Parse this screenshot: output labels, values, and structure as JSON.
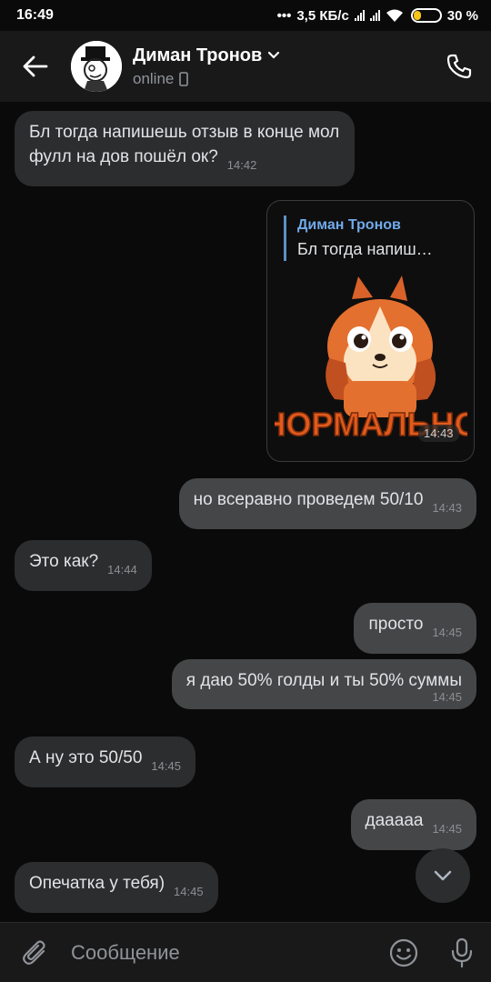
{
  "status_bar": {
    "time": "16:49",
    "network_speed": "3,5 КБ/с",
    "battery": "30 %",
    "battery_level": 0.3
  },
  "header": {
    "contact_name": "Диман Тронов",
    "status": "online",
    "icons": [
      "back-arrow-icon",
      "chevron-down-icon",
      "mobile-device-icon",
      "phone-icon"
    ]
  },
  "messages": [
    {
      "side": "in",
      "text": "Бл тогда напишешь отзыв в конце мол фулл на дов пошёл ок?",
      "time": "14:42"
    },
    {
      "side": "out",
      "type": "sticker",
      "reply_author": "Диман Тронов",
      "reply_text": "Бл тогда напиш…",
      "sticker_caption": "НОРМАЛЬНО",
      "time": "14:43"
    },
    {
      "side": "out",
      "text": "но всеравно проведем 50/10",
      "time": "14:43"
    },
    {
      "side": "in",
      "text": "Это как?",
      "time": "14:44"
    },
    {
      "side": "out",
      "text": "просто",
      "time": "14:45"
    },
    {
      "side": "out",
      "text": "я даю 50% голды и ты 50% суммы",
      "time": "14:45"
    },
    {
      "side": "in",
      "text": "А ну это 50/50",
      "time": "14:45"
    },
    {
      "side": "out",
      "text": "дааааа",
      "time": "14:45"
    },
    {
      "side": "in",
      "text": "Опечатка у тебя)",
      "time": "14:45"
    }
  ],
  "composer": {
    "placeholder": "Сообщение",
    "icons": [
      "paperclip-icon",
      "smile-icon",
      "microphone-icon"
    ]
  },
  "colors": {
    "background": "#0a0a0a",
    "incoming_bubble": "#2c2d2e",
    "outgoing_bubble": "#454647",
    "accent": "#71aaeb"
  }
}
